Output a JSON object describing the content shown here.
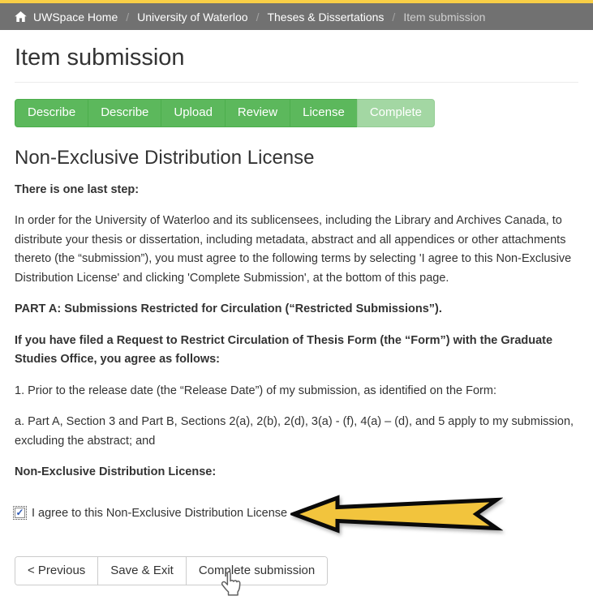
{
  "theme": {
    "accent_yellow": "#F8CE46",
    "header_gray": "#717171",
    "step_green": "#5cb85c",
    "step_green_light": "#a3d7a3",
    "arrow_yellow": "#F2C43D",
    "text_color": "#333333"
  },
  "breadcrumb": {
    "separator": "/",
    "items": [
      {
        "label": "UWSpace Home"
      },
      {
        "label": "University of Waterloo"
      },
      {
        "label": "Theses & Dissertations"
      },
      {
        "label": "Item submission"
      }
    ]
  },
  "page": {
    "title": "Item submission"
  },
  "progress": {
    "steps": [
      {
        "label": "Describe"
      },
      {
        "label": "Describe"
      },
      {
        "label": "Upload"
      },
      {
        "label": "Review"
      },
      {
        "label": "License"
      },
      {
        "label": "Complete"
      }
    ]
  },
  "license": {
    "heading": "Non-Exclusive Distribution License",
    "intro_bold": "There is one last step:",
    "para1": "In order for the University of Waterloo and its sublicensees, including the Library and Archives Canada, to distribute your thesis or dissertation, including metadata, abstract and all appendices or other attachments thereto (the “submission”), you must agree to the following terms by selecting 'I agree to this Non-Exclusive Distribution License' and clicking 'Complete Submission', at the bottom of this page.",
    "part_a": "PART A: Submissions Restricted for Circulation (“Restricted Submissions”).",
    "filed": "If you have filed a Request to Restrict Circulation of Thesis Form (the “Form”) with the Graduate Studies Office, you agree as follows:",
    "item1": "1. Prior to the release date (the “Release Date”) of my submission, as identified on the Form:",
    "item1a": "a. Part A, Section 3 and Part B, Sections 2(a), 2(b), 2(d), 3(a) - (f), 4(a) – (d), and 5 apply to my submission, excluding the abstract; and",
    "ndl_heading": "Non-Exclusive Distribution License:",
    "agree_label": "I agree to this Non-Exclusive Distribution License",
    "agree_checked": true
  },
  "actions": {
    "previous": "< Previous",
    "save_exit": "Save & Exit",
    "complete": "Complete submission"
  }
}
